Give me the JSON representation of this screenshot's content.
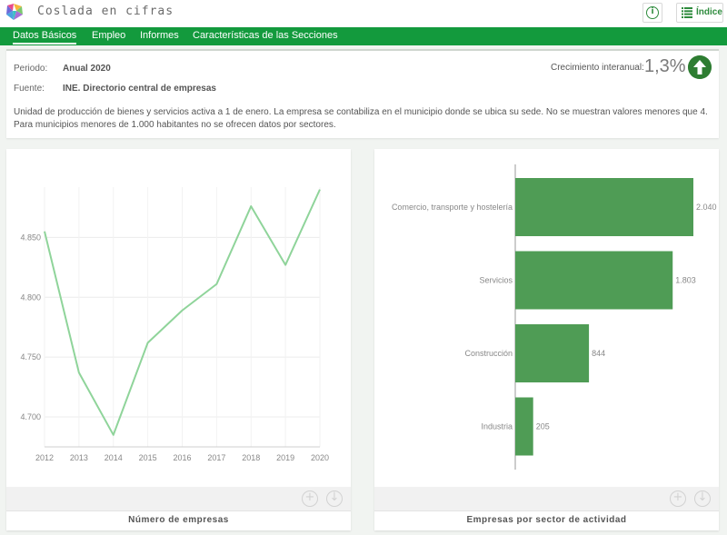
{
  "app": {
    "title": "Coslada en cifras"
  },
  "header": {
    "info_icon": "info-circle-icon",
    "index_label": "Índice",
    "index_icon": "list-icon"
  },
  "nav": {
    "items": [
      {
        "label": "Datos Básicos",
        "active": true
      },
      {
        "label": "Empleo",
        "active": false
      },
      {
        "label": "Informes",
        "active": false
      },
      {
        "label": "Características de las Secciones",
        "active": false
      }
    ]
  },
  "info": {
    "periodo_label": "Periodo:",
    "periodo_value": "Anual 2020",
    "fuente_label": "Fuente:",
    "fuente_value": "INE. Directorio central de empresas",
    "growth_label": "Crecimiento interanual:",
    "growth_value": "1,3%",
    "growth_direction": "up",
    "description": "Unidad de producción de bienes y servicios activa a 1 de enero. La empresa se contabiliza en el municipio donde se ubica su sede. No se muestran valores menores que 4. Para municipios menores de 1.000 habitantes no se ofrecen datos por sectores."
  },
  "colors": {
    "brand": "#139a3d",
    "line": "#8fd49a",
    "bar": "#4f9c55",
    "arrow": "#2e7d32"
  },
  "chart_data": [
    {
      "type": "line",
      "title": "Número de empresas",
      "x": [
        "2012",
        "2013",
        "2014",
        "2015",
        "2016",
        "2017",
        "2018",
        "2019",
        "2020"
      ],
      "series": [
        {
          "values": [
            4855,
            4737,
            4685,
            4762,
            4789,
            4811,
            4876,
            4827,
            4890
          ]
        }
      ],
      "ylim": [
        4675,
        4892
      ],
      "yticks": [
        4700,
        4750,
        4800,
        4850
      ],
      "ytick_labels": [
        "4.700",
        "4.750",
        "4.800",
        "4.850"
      ],
      "grid": true
    },
    {
      "type": "bar",
      "orientation": "horizontal",
      "title": "Empresas por sector de actividad",
      "categories": [
        "Comercio, transporte y hostelería",
        "Servicios",
        "Construcción",
        "Industria"
      ],
      "values": [
        2040,
        1803,
        844,
        205
      ],
      "value_labels": [
        "2.040",
        "1.803",
        "844",
        "205"
      ]
    }
  ],
  "tools": {
    "zoom_icon": "plus-circle-icon",
    "download_icon": "download-circle-icon"
  }
}
